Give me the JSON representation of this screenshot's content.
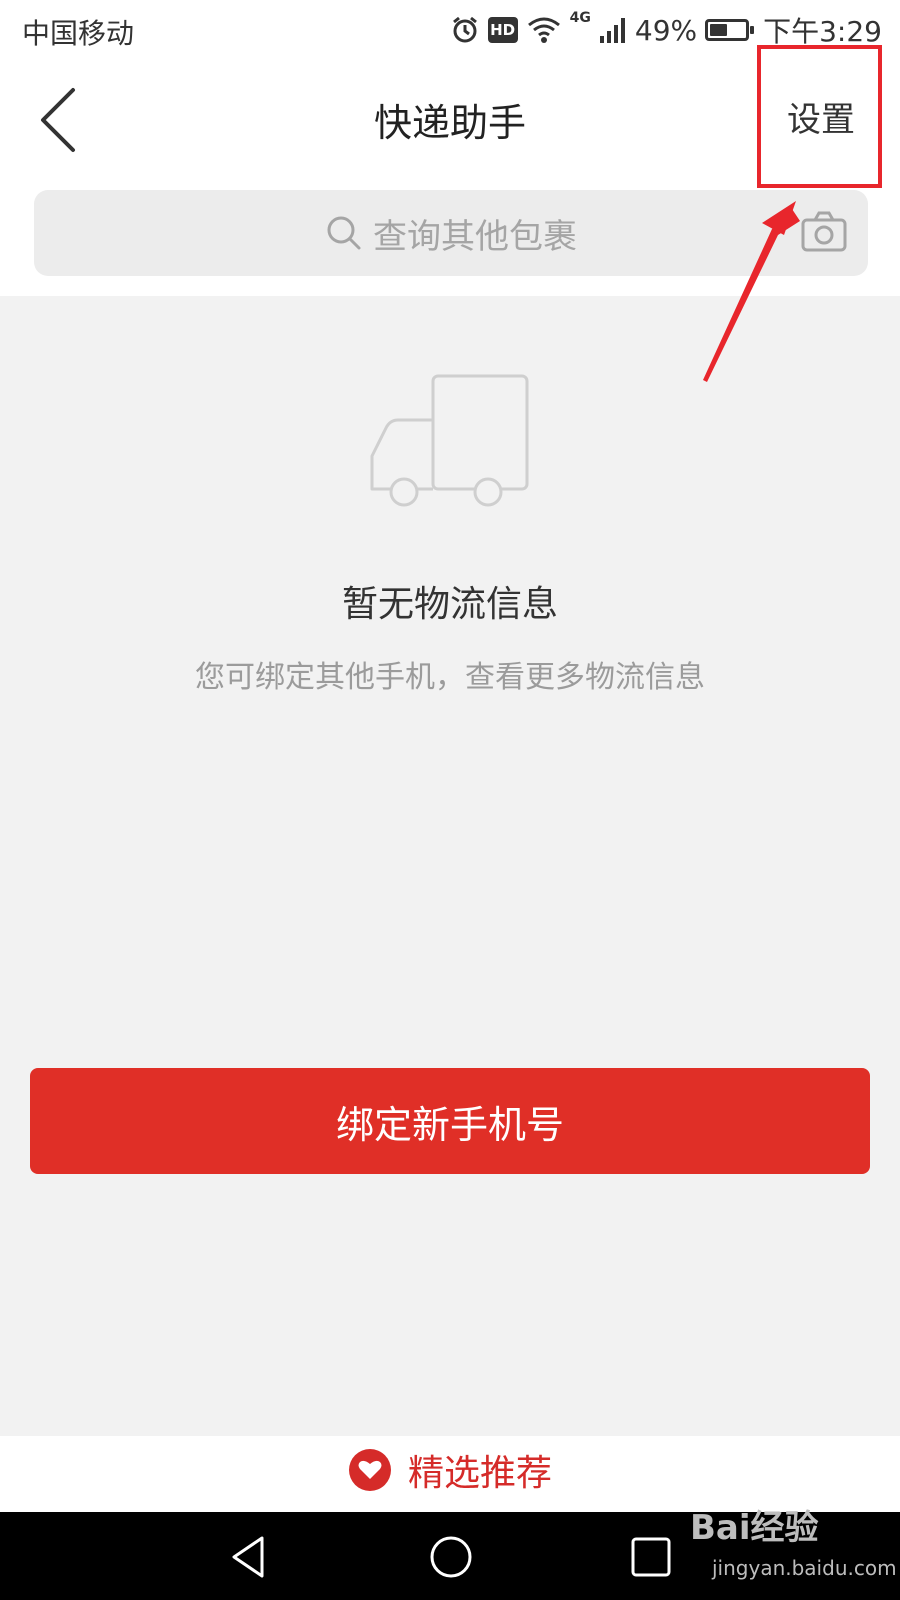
{
  "status_bar": {
    "carrier": "中国移动",
    "network": "4G",
    "battery_level": 0.49,
    "battery_text": "49%",
    "time": "下午3:29",
    "hd_label": "HD",
    "icons": [
      "alarm-icon",
      "wifi-icon",
      "signal-icon",
      "battery-icon"
    ]
  },
  "nav": {
    "back_icon": "chevron-left-icon",
    "title": "快递助手",
    "settings_label": "设置"
  },
  "search": {
    "icon": "search-icon",
    "placeholder": "查询其他包裹",
    "camera_icon": "camera-icon"
  },
  "empty_state": {
    "icon": "truck-icon",
    "title": "暂无物流信息",
    "subtitle": "您可绑定其他手机，查看更多物流信息"
  },
  "bind_button": {
    "label": "绑定新手机号",
    "color": "#e02f27"
  },
  "featured": {
    "icon": "heart-badge-icon",
    "label": "精选推荐",
    "color": "#d52b29"
  },
  "system_nav": {
    "buttons": [
      "back-triangle-icon",
      "home-circle-icon",
      "recents-square-icon"
    ]
  },
  "annotation": {
    "highlight_color": "#e8262c"
  },
  "watermark": {
    "logo": "Bai经验",
    "url": "jingyan.baidu.com"
  }
}
